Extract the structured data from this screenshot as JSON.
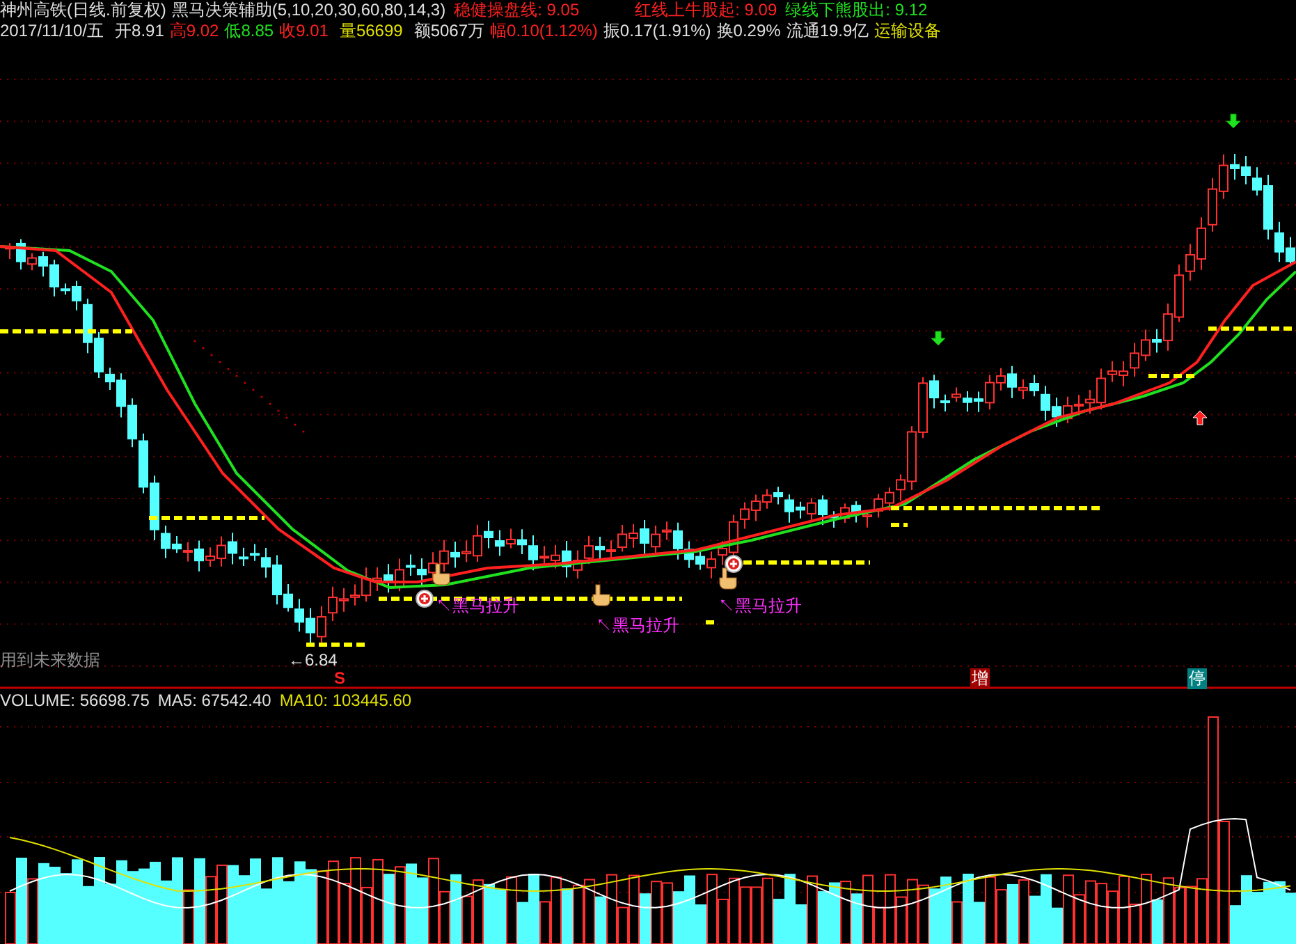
{
  "header": {
    "title": "神州高铁(日线.前复权)",
    "indicator": "黑马决策辅助(5,10,20,30,60,80,14,3)",
    "indicator_values": [
      {
        "text": "稳健操盘线: 9.05",
        "color": "#ff2020"
      },
      {
        "text": "红线上牛股起: 9.09",
        "color": "#ff2020"
      },
      {
        "text": "绿线下熊股出: 9.12",
        "color": "#20e020"
      }
    ]
  },
  "quote": {
    "date": "2017/11/10/五",
    "items": [
      {
        "label": "开",
        "value": "8.91",
        "color": "#e0e0e0"
      },
      {
        "label": "高",
        "value": "9.02",
        "color": "#ff2020"
      },
      {
        "label": "低",
        "value": "8.85",
        "color": "#20e020"
      },
      {
        "label": "收",
        "value": "9.01",
        "color": "#ff2020"
      },
      {
        "label": "量",
        "value": "56699",
        "color": "#e0e000"
      },
      {
        "label": "额",
        "value": "5067万",
        "color": "#e0e0e0"
      },
      {
        "label": "幅",
        "value": "0.10(1.12%)",
        "color": "#ff2020"
      },
      {
        "label": "振",
        "value": "0.17(1.91%)",
        "color": "#e0e0e0"
      },
      {
        "label": "换",
        "value": "0.29%",
        "color": "#e0e0e0"
      },
      {
        "label": "流通",
        "value": "19.9亿",
        "color": "#e0e0e0"
      }
    ],
    "sector": "运输设备"
  },
  "chart": {
    "signals": [
      "↖黑马拉升",
      "↖黑马拉升",
      "↖黑马拉升"
    ],
    "low_label": "←6.84",
    "warning": "用到未来数据",
    "badges": [
      {
        "text": "S",
        "kind": "sell"
      },
      {
        "text": "增",
        "kind": "add"
      },
      {
        "text": "停",
        "kind": "halt"
      }
    ]
  },
  "volume": {
    "items": [
      {
        "text": "VOLUME: 56698.75",
        "color": "#e0e0e0"
      },
      {
        "text": "MA5: 67542.40",
        "color": "#e0e0e0"
      },
      {
        "text": "MA10: 103445.60",
        "color": "#e0e000"
      }
    ]
  }
}
